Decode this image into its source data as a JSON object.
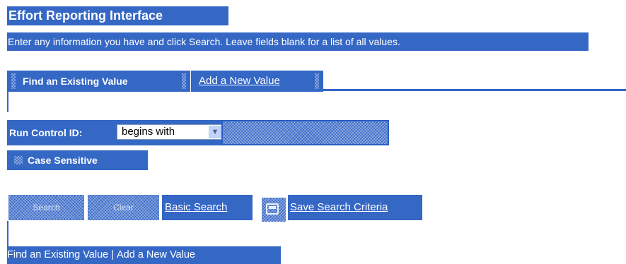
{
  "page": {
    "title": "Effort Reporting Interface",
    "instructions": "Enter any information you have and click Search. Leave fields blank for a list of all values."
  },
  "tabs": [
    {
      "label": "Find an Existing Value",
      "active": true
    },
    {
      "label": "Add a New Value",
      "active": false
    }
  ],
  "form": {
    "run_control_label": "Run Control ID:",
    "operator_selected": "begins with",
    "run_control_value": "",
    "case_sensitive_label": "Case Sensitive",
    "case_sensitive_checked": false
  },
  "actions": {
    "search_label": "Search",
    "clear_label": "Clear",
    "basic_search_label": "Basic Search",
    "save_search_icon": "save-icon",
    "save_search_label": "Save Search Criteria"
  },
  "footer_links": {
    "find_label": "Find an Existing Value",
    "separator": "|",
    "add_label": "Add a New Value"
  },
  "colors": {
    "highlight": "#3567c5",
    "background": "#ffffff"
  }
}
